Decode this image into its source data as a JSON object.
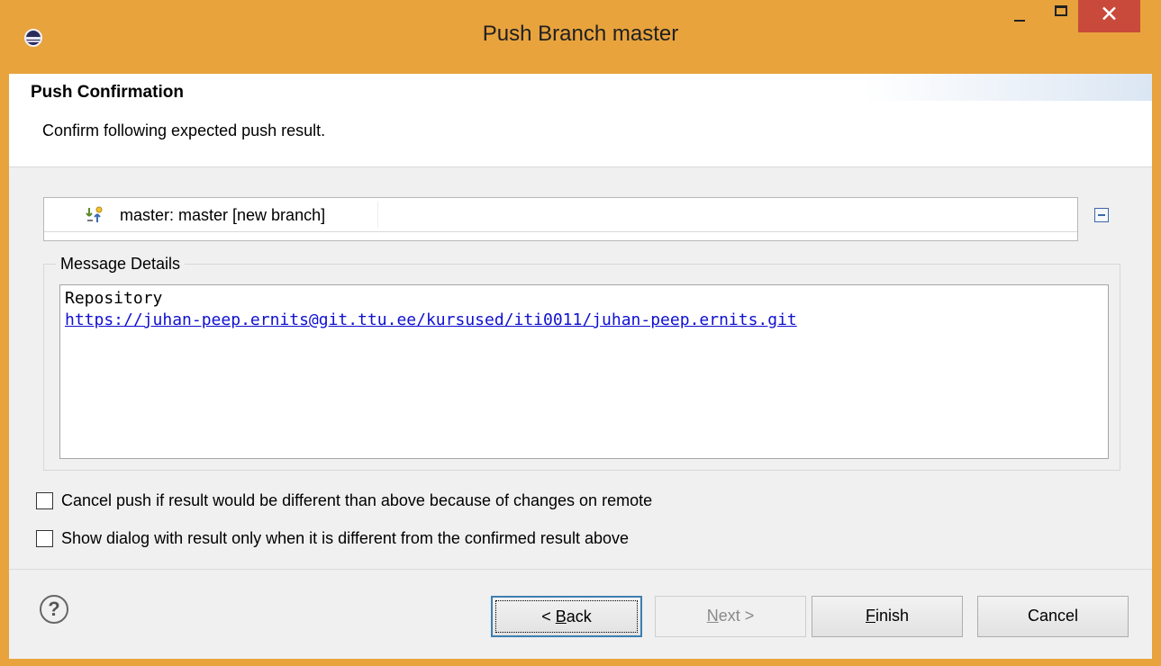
{
  "window": {
    "title": "Push Branch master",
    "close_glyph": "✕"
  },
  "header": {
    "title": "Push Confirmation",
    "description": "Confirm following expected push result."
  },
  "result_tree": {
    "item_label": "master: master [new branch]",
    "item_icon": "branch-push-icon"
  },
  "message_details": {
    "legend": "Message Details",
    "line1": "Repository",
    "url": "https://juhan-peep.ernits@git.ttu.ee/kursused/iti0011/juhan-peep.ernits.git"
  },
  "options": {
    "cancel_if_different": "Cancel push if result would be different than above because of changes on remote",
    "show_only_if_different": "Show dialog with result only when it is different from the confirmed result above"
  },
  "footer": {
    "help_glyph": "?",
    "back_prefix": "< ",
    "back_mnemonic": "B",
    "back_rest": "ack",
    "next_mnemonic": "N",
    "next_rest": "ext >",
    "finish_mnemonic": "F",
    "finish_rest": "inish",
    "cancel_label": "Cancel"
  },
  "colors": {
    "titlebar": "#e8a33d",
    "close_button": "#c94a3b",
    "link": "#1010d0",
    "default_button_border": "#3c7fb1"
  }
}
